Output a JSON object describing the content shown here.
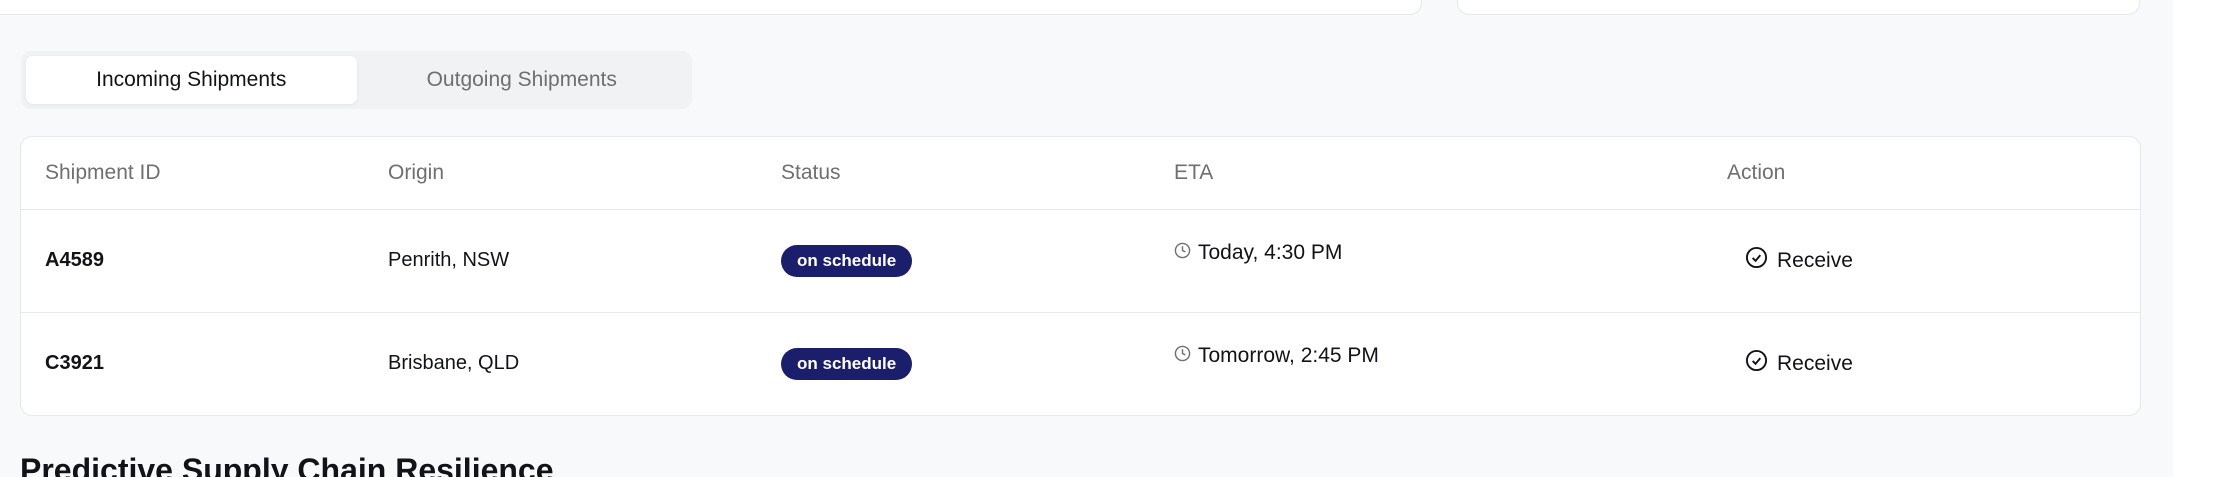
{
  "tabs": [
    {
      "label": "Incoming Shipments",
      "active": true
    },
    {
      "label": "Outgoing Shipments",
      "active": false
    }
  ],
  "table": {
    "headers": [
      "Shipment ID",
      "Origin",
      "Status",
      "ETA",
      "Action"
    ],
    "rows": [
      {
        "id": "A4589",
        "origin": "Penrith, NSW",
        "status": "on schedule",
        "eta": "Today, 4:30 PM",
        "action": "Receive"
      },
      {
        "id": "C3921",
        "origin": "Brisbane, QLD",
        "status": "on schedule",
        "eta": "Tomorrow, 2:45 PM",
        "action": "Receive"
      }
    ]
  },
  "section": {
    "title": "Predictive Supply Chain Resilience"
  },
  "colors": {
    "badge": "#1b1f6b",
    "page_bg": "#f8f9fa"
  },
  "icons": {
    "eta": "clock-icon",
    "action": "check-circle-icon"
  }
}
